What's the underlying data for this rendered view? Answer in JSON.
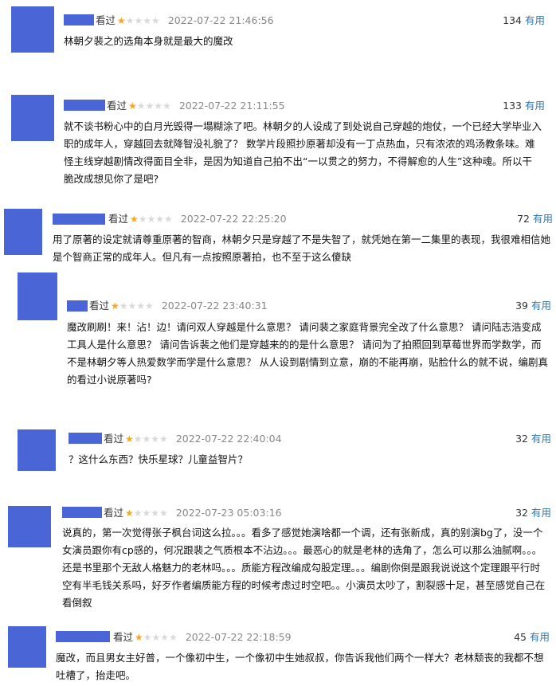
{
  "colors": {
    "avatar_placeholder": "#4a66d6",
    "star_on": "#f5a623",
    "star_off": "#d9d9d9",
    "useful_link": "#3377aa",
    "time": "#888888"
  },
  "reviews": [
    {
      "status": "看过",
      "rating": "1 of 5 stars",
      "time": "2022-07-22 21:46:56",
      "votes": "134",
      "useful_label": "有用",
      "content": "林朝夕裴之的选角本身就是最大的魔改"
    },
    {
      "status": "看过",
      "rating": "1 of 5 stars",
      "time": "2022-07-22 21:11:55",
      "votes": "133",
      "useful_label": "有用",
      "content": "就不谈书粉心中的白月光毁得一塌糊涂了吧。林朝夕的人设成了到处说自己穿越的炮仗，一个已经大学毕业入职的成年人，穿越回去就降智没礼貌了？ 数学片段照抄原著却没有一丁点热血，只有浓浓的鸡汤教条味。难怪主线穿越剧情改得面目全非，是因为知道自己拍不出“一以贯之的努力，不得解愈的人生”这种魂。所以干脆改成想见你了是吧?"
    },
    {
      "status": "看过",
      "rating": "1 of 5 stars",
      "time": "2022-07-22 22:25:20",
      "votes": "72",
      "useful_label": "有用",
      "content": "用了原著的设定就请尊重原著的智商，林朝夕只是穿越了不是失智了，就凭她在第一二集里的表现，我很难相信她是个智商正常的成年人。但凡有一点按照原著拍，也不至于这么傻缺"
    },
    {
      "status": "看过",
      "rating": "1 of 5 stars",
      "time": "2022-07-22 23:40:31",
      "votes": "39",
      "useful_label": "有用",
      "content": "魔改刷刷！来！沾！边！请问双人穿越是什么意思？ 请问裴之家庭背景完全改了什么意思？ 请问陆志浩变成工具人是什么意思？ 请问告诉裴之他们是穿越来的的是什么意思？ 请问为了拍照回到草莓世界而学数学，而不是林朝夕等人热爱数学而学是什么意思？ 从人设到剧情到立意，崩的不能再崩，贴脸什么的就不说，编剧真的看过小说原著吗?"
    },
    {
      "status": "看过",
      "rating": "1 of 5 stars",
      "time": "2022-07-22 22:40:04",
      "votes": "32",
      "useful_label": "有用",
      "content": "？这什么东西？快乐星球？儿童益智片？"
    },
    {
      "status": "看过",
      "rating": "1 of 5 stars",
      "time": "2022-07-23 05:03:16",
      "votes": "32",
      "useful_label": "有用",
      "content": "说真的，第一次觉得张子枫台词这么拉。。。看多了感觉她演啥都一个调，还有张新成，真的别演bg了，没一个女演员跟你有cp感的，何况跟裴之气质根本不沾边。。。最恶心的就是老林的选角了，怎么可以那么油腻啊。。。还是书里那个无敌人格魅力的老林吗。。。质能方程改编成勾股定理。。。编剧你倒是跟我说说这个定理跟平行时空有半毛钱关系吗，好歹作者编质能方程的时候考虑过时空吧。。小演员太吵了，割裂感十足，甚至感觉自己在看倒叙"
    },
    {
      "status": "看过",
      "rating": "1 of 5 stars",
      "time": "2022-07-22 22:18:59",
      "votes": "45",
      "useful_label": "有用",
      "content": "魔改，而且男女主好普，一个像初中生，一个像初中生她叔叔，你告诉我他们两个一样大？老林颓丧的我都不想吐槽了，抬走吧。"
    }
  ]
}
